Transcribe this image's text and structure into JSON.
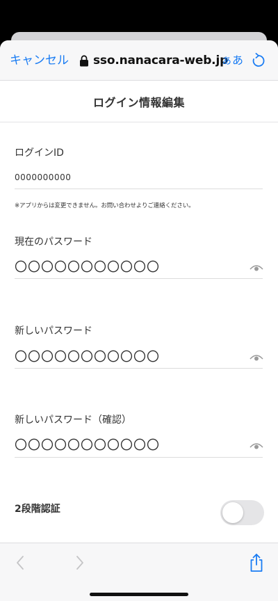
{
  "browser": {
    "cancel_label": "キャンセル",
    "url": "sso.nanacara-web.jp",
    "text_size_label": "ぁあ",
    "lock_icon": "lock-icon",
    "reload_icon": "reload-icon"
  },
  "page": {
    "title": "ログイン情報編集"
  },
  "form": {
    "login_id": {
      "label": "ログインID",
      "value": "0000000000",
      "note": "※アプリからは変更できません。お問い合わせよりご連絡ください。"
    },
    "current_password": {
      "label": "現在のパスワード",
      "placeholder": "〇〇〇〇〇〇〇〇〇〇〇"
    },
    "new_password": {
      "label": "新しいパスワード",
      "placeholder": "〇〇〇〇〇〇〇〇〇〇〇"
    },
    "confirm_password": {
      "label": "新しいパスワード（確認）",
      "placeholder": "〇〇〇〇〇〇〇〇〇〇〇"
    },
    "two_factor": {
      "label": "2段階認証",
      "enabled": false
    }
  },
  "toolbar": {
    "back_icon": "chevron-left-icon",
    "forward_icon": "chevron-right-icon",
    "share_icon": "share-icon"
  },
  "colors": {
    "accent": "#1a7cf3",
    "text": "#333333",
    "toggle_off": "#e5e5e7"
  }
}
